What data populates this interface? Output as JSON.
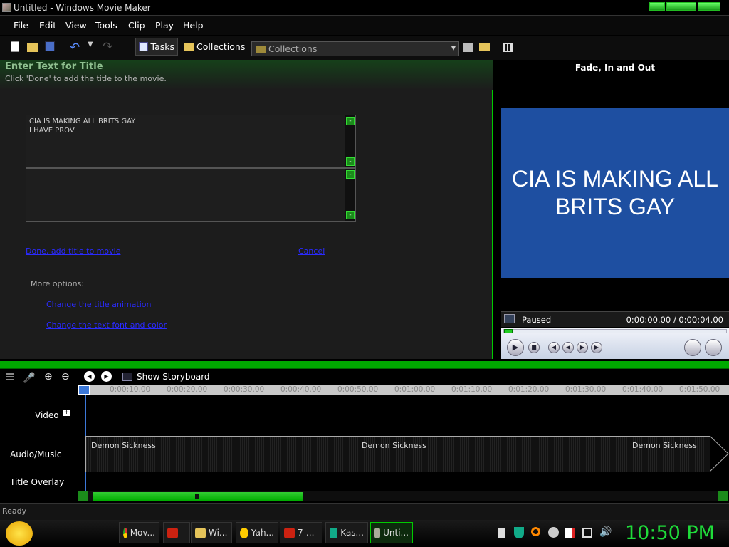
{
  "window": {
    "title": "Untitled - Windows Movie Maker"
  },
  "menu": [
    "File",
    "Edit",
    "View",
    "Tools",
    "Clip",
    "Play",
    "Help"
  ],
  "toolbar": {
    "tasks_label": "Tasks",
    "collections_label": "Collections",
    "collections_dropdown": "Collections"
  },
  "task_pane": {
    "title": "Enter Text for Title",
    "subtitle": "Click 'Done' to add the title to the movie.",
    "text_primary": "CIA IS MAKING ALL BRITS GAY\nI HAVE PROV",
    "text_secondary": "",
    "done_link": "Done, add title to movie",
    "cancel_link": "Cancel",
    "more_options": "More options:",
    "option_animation": "Change the title animation",
    "option_font": "Change the text font and color"
  },
  "preview": {
    "effect_name": "Fade, In and Out",
    "display_text": "CIA IS MAKING ALL BRITS GAY",
    "status": "Paused",
    "time": "0:00:00.00 / 0:00:04.00",
    "progress": 0.0
  },
  "timeline": {
    "show_storyboard": "Show Storyboard",
    "ruler_ticks": [
      "0:00:10.00",
      "0:00:20.00",
      "0:00:30.00",
      "0:00:40.00",
      "0:00:50.00",
      "0:01:00.00",
      "0:01:10.00",
      "0:01:20.00",
      "0:01:30.00",
      "0:01:40.00",
      "0:01:50.00"
    ],
    "tracks": {
      "video": "Video",
      "audio": "Audio/Music",
      "title_overlay": "Title Overlay"
    },
    "audio_clip_name": "Demon Sickness"
  },
  "status_bar": {
    "text": "Ready"
  },
  "taskbar": {
    "items": [
      {
        "label": "Mov...",
        "icon": "chrome-icon"
      },
      {
        "label": "",
        "icon": "bull-icon"
      },
      {
        "label": "Wi...",
        "icon": "folder-icon"
      },
      {
        "label": "Yah...",
        "icon": "yahoo-messenger-icon"
      },
      {
        "label": "7-...",
        "icon": "bull-icon"
      },
      {
        "label": "Kas...",
        "icon": "kaspersky-icon"
      },
      {
        "label": "Unti...",
        "icon": "movie-maker-icon"
      }
    ],
    "clock": "10:50 PM"
  },
  "colors": {
    "accent_green": "#00aa00",
    "preview_bg": "#1e4fa1",
    "link_blue": "#2a2aff"
  }
}
